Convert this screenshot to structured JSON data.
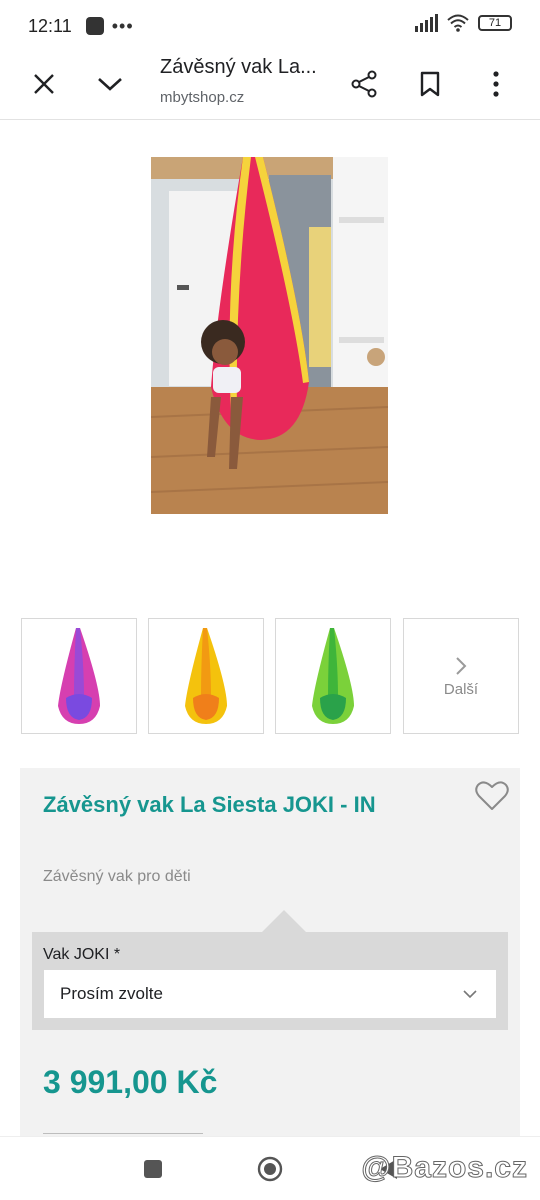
{
  "status": {
    "time": "12:11",
    "battery": "71"
  },
  "toolbar": {
    "title": "Závěsný vak La...",
    "url": "mbytshop.cz"
  },
  "icons": [
    "close-icon",
    "chevron-down-icon",
    "share-icon",
    "bookmark-icon",
    "more-vert-icon",
    "heart-icon",
    "chevron-right-icon"
  ],
  "thumbnails": [
    {
      "color": "#d63fb0",
      "accent": "#7a4ae0"
    },
    {
      "color": "#f4c20d",
      "accent": "#f07f1a"
    },
    {
      "color": "#5cc530",
      "accent": "#2aa24a"
    }
  ],
  "thumb_next_label": "Další",
  "product": {
    "title": "Závěsný vak La Siesta JOKI - IN",
    "subtitle": "Závěsný vak pro děti",
    "variant_label": "Vak JOKI *",
    "variant_value": "Prosím zvolte",
    "price": "3 991,00 Kč"
  },
  "colors": {
    "accent": "#16968f"
  },
  "watermark": "@Bazos.cz"
}
